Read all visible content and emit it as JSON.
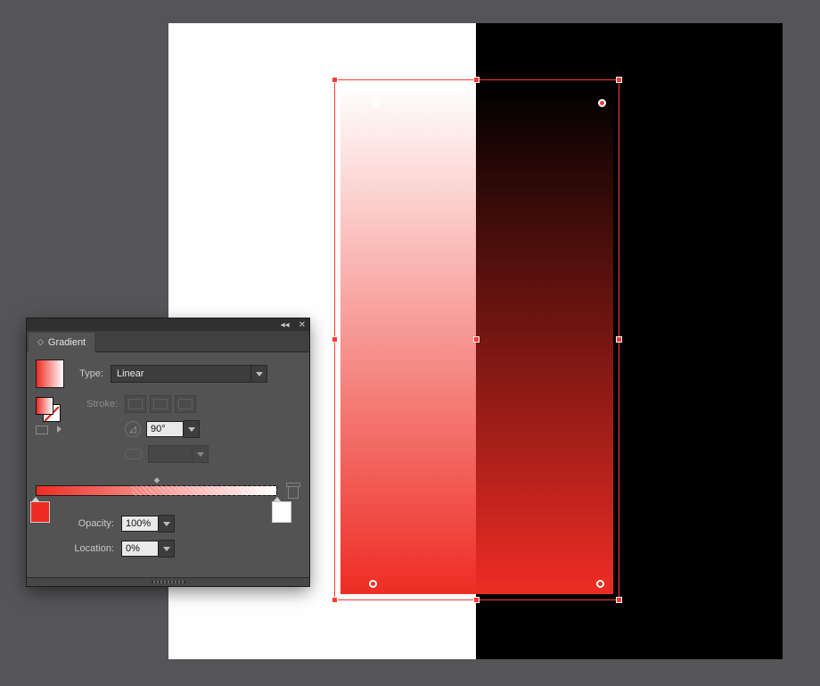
{
  "panel": {
    "title": "Gradient",
    "tab_glyph": "◇",
    "type_label": "Type:",
    "type_value": "Linear",
    "stroke_label": "Stroke:",
    "angle_value": "90°",
    "aspect_value": "",
    "opacity_label": "Opacity:",
    "opacity_value": "100%",
    "location_label": "Location:",
    "location_value": "0%"
  },
  "gradient": {
    "start_color": "#ee2c24",
    "end_color": "#ffffff",
    "angle_deg": 90,
    "stops": [
      {
        "pos": 0,
        "color": "#ee2c24",
        "opacity": 100
      },
      {
        "pos": 100,
        "color": "#ffffff",
        "opacity": 0
      }
    ]
  },
  "icons": {
    "collapse": "◂◂",
    "close": "✕",
    "dropdown": "▼"
  }
}
